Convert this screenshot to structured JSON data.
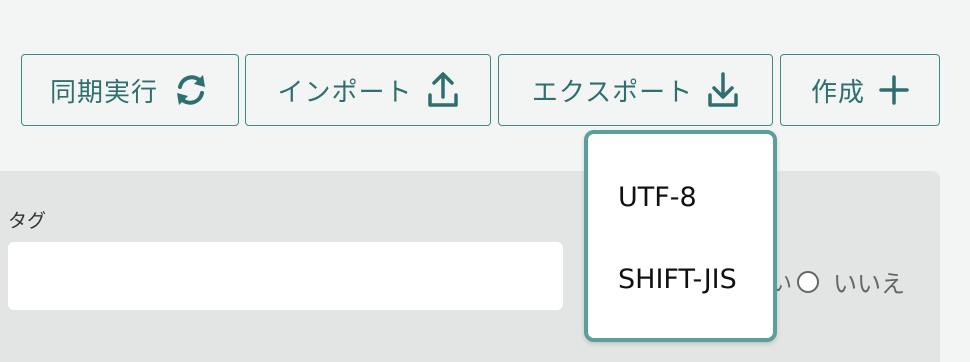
{
  "toolbar": {
    "sync_label": "同期実行",
    "import_label": "インポート",
    "export_label": "エクスポート",
    "create_label": "作成"
  },
  "form": {
    "tag_label": "タグ",
    "tag_value": "",
    "radio_partial": "い",
    "radio_no_label": "いいえ"
  },
  "export_menu": {
    "options": [
      "UTF-8",
      "SHIFT-JIS"
    ]
  },
  "colors": {
    "accent": "#3d8a8a",
    "menu_border": "#5a9e9e",
    "panel_bg": "#e3e4e4",
    "page_bg": "#f3f4f4"
  }
}
